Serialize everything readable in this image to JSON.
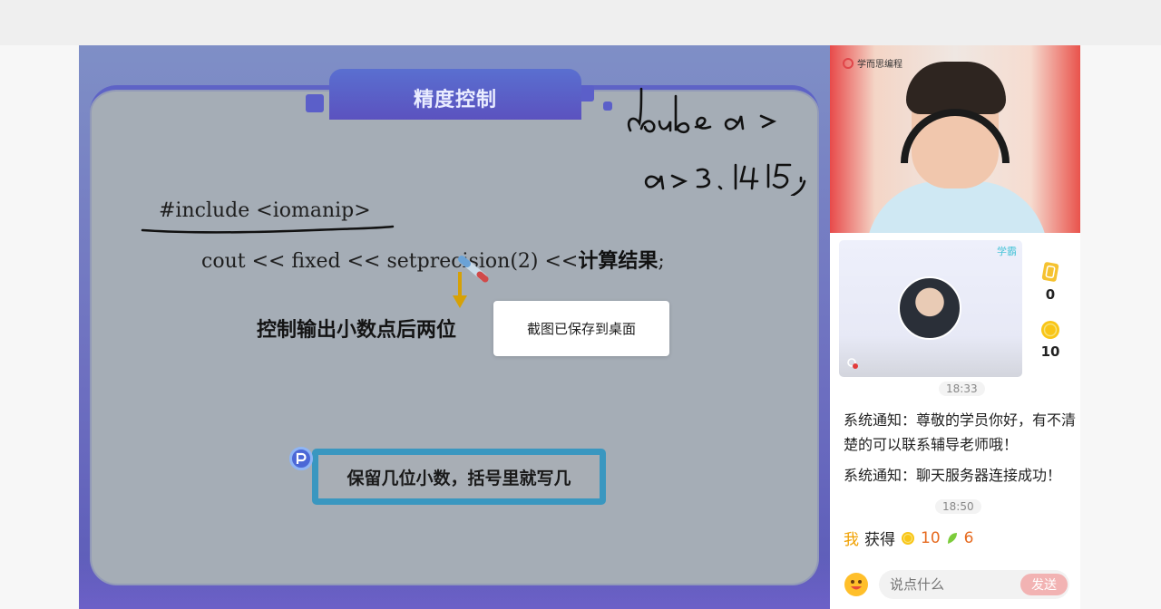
{
  "slide": {
    "title": "精度控制",
    "code_include": "#include <iomanip>",
    "code_cout": "cout << fixed << setprecision(2) <<",
    "code_result": "计算结果",
    "code_semicolon": ";",
    "description": "控制输出小数点后两位",
    "hint": "保留几位小数，括号里就写几",
    "handwriting_line1": "doube a;",
    "handwriting_line2": "a=3.1415;"
  },
  "toast": {
    "message": "截图已保存到桌面"
  },
  "side": {
    "brand": "学而思编程",
    "student_tag": "学霸",
    "stats": [
      {
        "icon": "card-icon",
        "value": "0"
      },
      {
        "icon": "coin-icon",
        "value": "10"
      }
    ],
    "time1": "18:33",
    "messages": [
      "系统通知：尊敬的学员你好，有不清楚的可以联系辅导老师哦！",
      "系统通知：聊天服务器连接成功！"
    ],
    "time2": "18:50",
    "reward": {
      "me": "我",
      "got": "获得",
      "coins": "10",
      "leaves": "6"
    },
    "chat_placeholder": "说点什么",
    "send_label": "发送"
  }
}
